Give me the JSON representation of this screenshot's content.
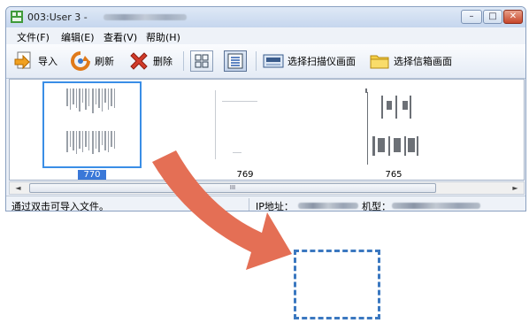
{
  "window": {
    "title": "003:User 3 - ",
    "buttons": {
      "minimize": "–",
      "maximize": "□",
      "close": "✕"
    }
  },
  "menu": [
    "文件(F)",
    "编辑(E)",
    "查看(V)",
    "帮助(H)"
  ],
  "toolbar": {
    "import_label": "导入",
    "refresh_label": "刷新",
    "delete_label": "删除",
    "select_scanner_label": "选择扫描仪画面",
    "select_mailbox_label": "选择信箱画面"
  },
  "thumbnails": [
    {
      "label": "770",
      "selected": true
    },
    {
      "label": "769",
      "selected": false
    },
    {
      "label": "765",
      "selected": false
    }
  ],
  "scrollbar": {
    "left_arrow": "◄",
    "right_arrow": "►",
    "grip": "III"
  },
  "status": {
    "hint": "通过双击可导入文件。",
    "ip_label": "IP地址：",
    "model_label": "机型："
  },
  "colors": {
    "arrow": "#e46f55",
    "selection": "#3a8ee6",
    "dropzone": "#3b78c0"
  },
  "icons": [
    "app-icon",
    "import-icon",
    "refresh-icon",
    "delete-icon",
    "thumbnail-view-icon",
    "list-view-icon",
    "scanner-icon",
    "folder-icon",
    "drag-arrow"
  ]
}
